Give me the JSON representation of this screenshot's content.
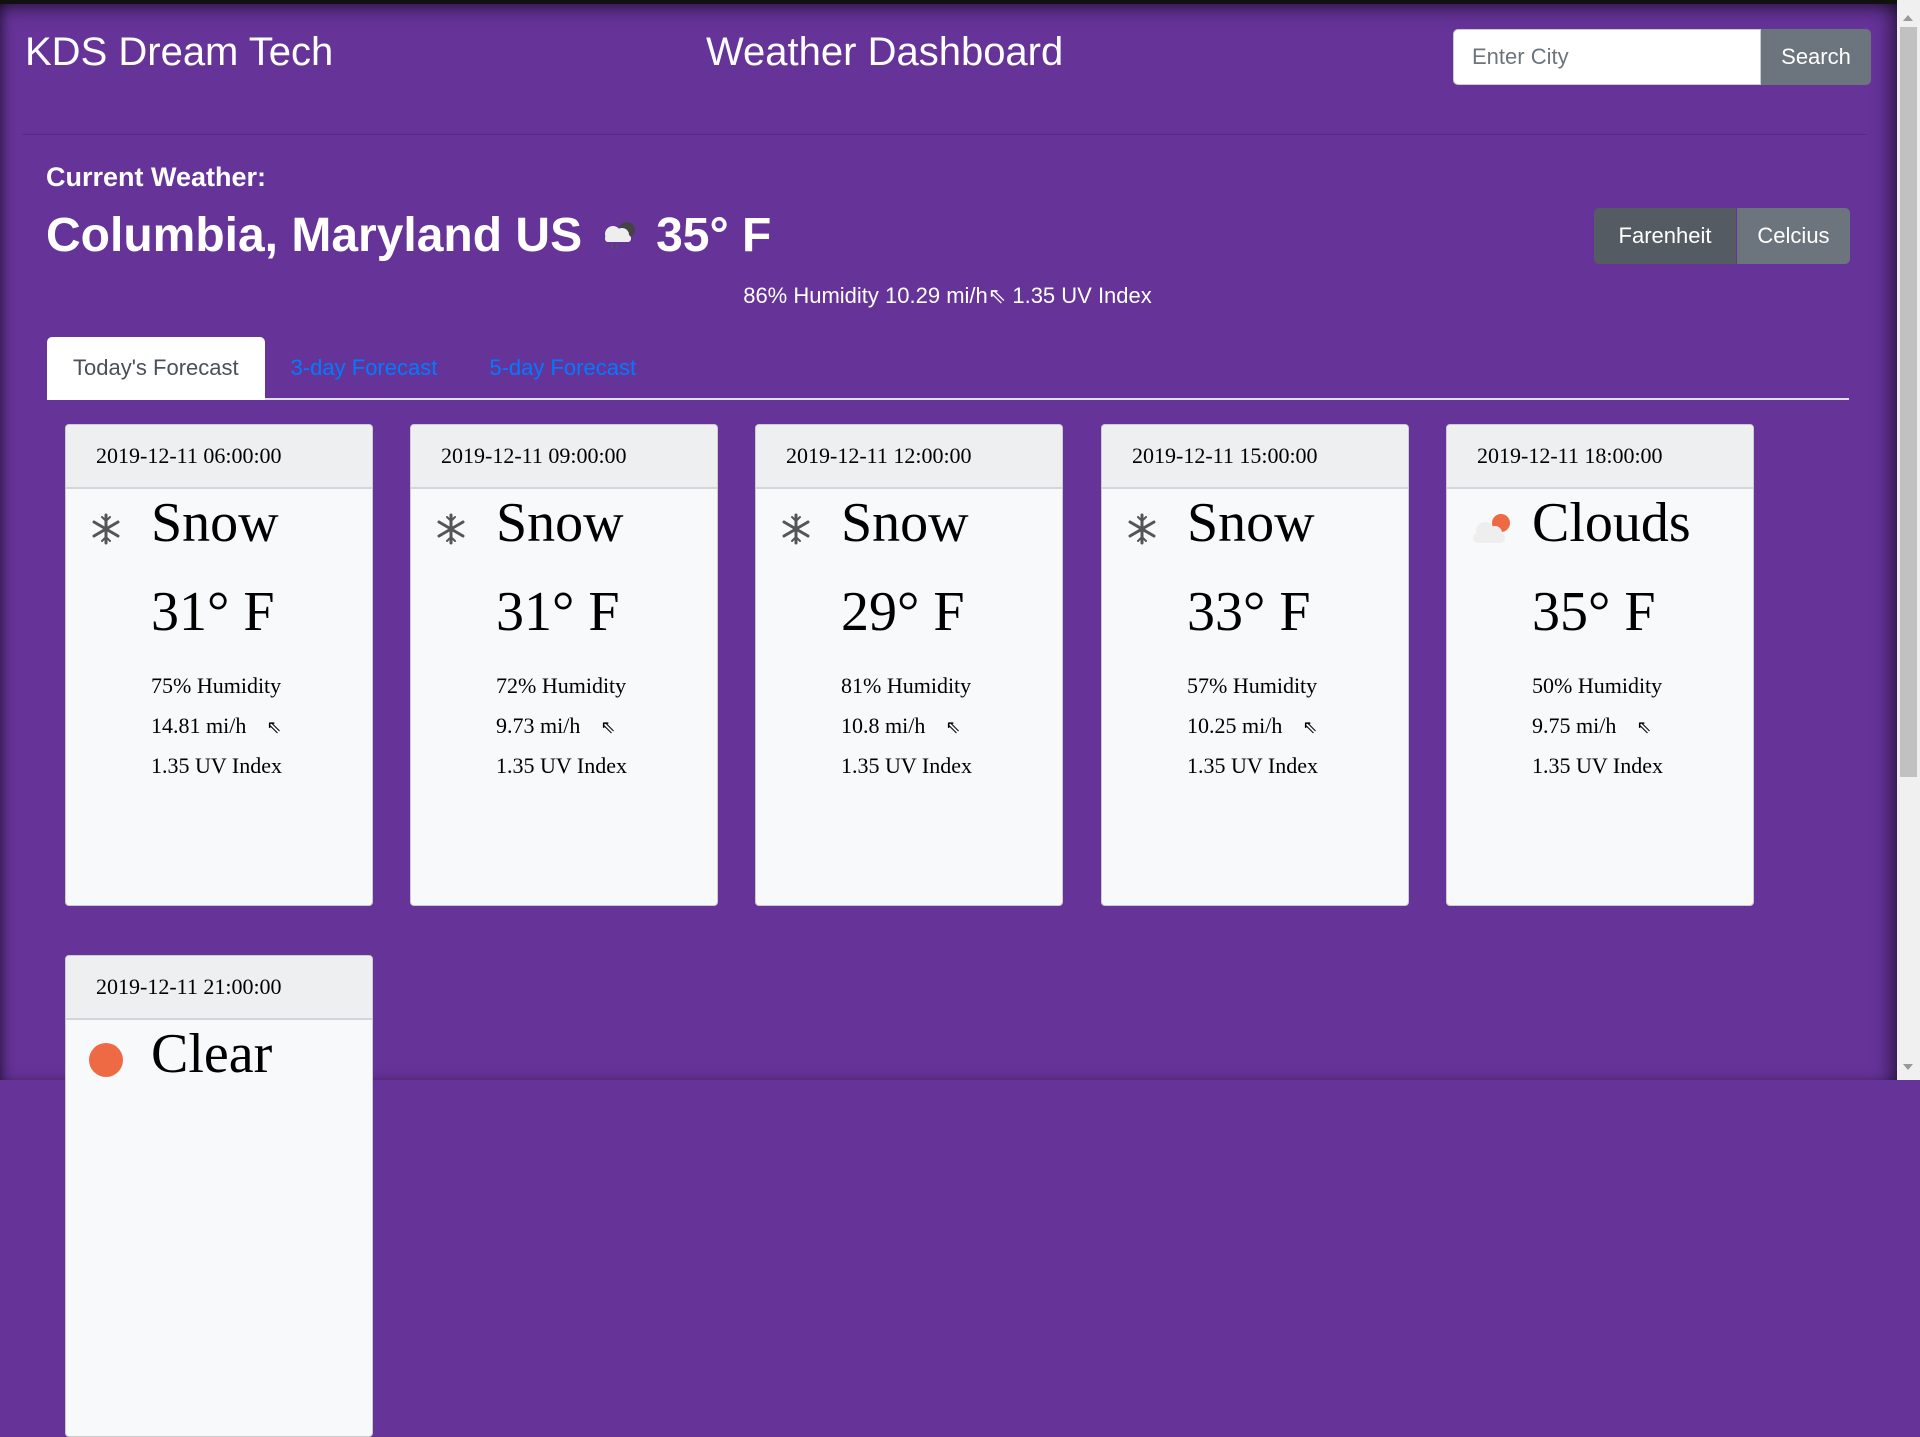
{
  "header": {
    "brand": "KDS Dream Tech",
    "title": "Weather Dashboard",
    "search_placeholder": "Enter City",
    "search_label": "Search"
  },
  "current": {
    "label": "Current Weather:",
    "city": "Columbia, Maryland US",
    "icon": "cloud-rain-icon",
    "temp": "35° F",
    "humidity": "86% Humidity",
    "wind": "10.29 mi/h",
    "wind_icon": "⇖",
    "uv": "1.35 UV Index"
  },
  "units": {
    "fahrenheit": "Farenheit",
    "celsius": "Celcius",
    "selected": "Farenheit"
  },
  "tabs": [
    {
      "label": "Today's Forecast",
      "active": true
    },
    {
      "label": "3-day Forecast"
    },
    {
      "label": "5-day Forecast"
    }
  ],
  "forecast": [
    {
      "time": "2019-12-11 06:00:00",
      "condition": "Snow",
      "icon": "snowflake-icon",
      "temp": "31° F",
      "humidity": "75% Humidity",
      "wind": "14.81 mi/h",
      "uv": "1.35 UV Index"
    },
    {
      "time": "2019-12-11 09:00:00",
      "condition": "Snow",
      "icon": "snowflake-icon",
      "temp": "31° F",
      "humidity": "72% Humidity",
      "wind": "9.73 mi/h",
      "uv": "1.35 UV Index"
    },
    {
      "time": "2019-12-11 12:00:00",
      "condition": "Snow",
      "icon": "snowflake-icon",
      "temp": "29° F",
      "humidity": "81% Humidity",
      "wind": "10.8 mi/h",
      "uv": "1.35 UV Index"
    },
    {
      "time": "2019-12-11 15:00:00",
      "condition": "Snow",
      "icon": "snowflake-icon",
      "temp": "33° F",
      "humidity": "57% Humidity",
      "wind": "10.25 mi/h",
      "uv": "1.35 UV Index"
    },
    {
      "time": "2019-12-11 18:00:00",
      "condition": "Clouds",
      "icon": "cloud-sun-icon",
      "temp": "35° F",
      "humidity": "50% Humidity",
      "wind": "9.75 mi/h",
      "uv": "1.35 UV Index"
    },
    {
      "time": "2019-12-11 21:00:00",
      "condition": "Clear",
      "icon": "sun-icon"
    }
  ],
  "colors": {
    "background": "#663399",
    "link": "#007bff",
    "button": "#6c757d",
    "sun": "#ee6a45"
  }
}
